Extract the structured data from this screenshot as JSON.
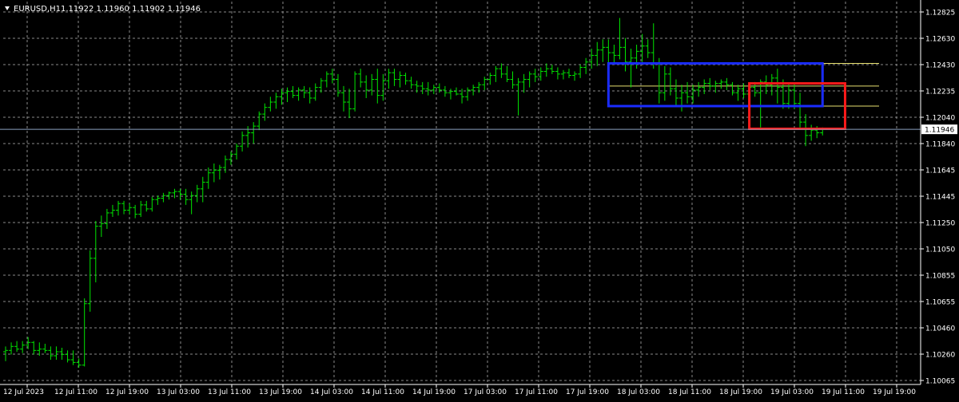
{
  "header": {
    "symbol": "EURUSD,H1",
    "ohlc": "1.11922 1.11960 1.11902 1.11946"
  },
  "chart_data": {
    "type": "ohlc",
    "title": "EURUSD,H1",
    "ylim": [
      1.10065,
      1.12825
    ],
    "y_ticks": [
      "1.12825",
      "1.12630",
      "1.12430",
      "1.12235",
      "1.12040",
      "1.11840",
      "1.11645",
      "1.11445",
      "1.11250",
      "1.11050",
      "1.10855",
      "1.10655",
      "1.10460",
      "1.10260",
      "1.10065"
    ],
    "x_ticks": [
      "12 Jul 2023",
      "12 Jul 11:00",
      "12 Jul 19:00",
      "13 Jul 03:00",
      "13 Jul 11:00",
      "13 Jul 19:00",
      "14 Jul 03:00",
      "14 Jul 11:00",
      "14 Jul 19:00",
      "17 Jul 03:00",
      "17 Jul 11:00",
      "17 Jul 19:00",
      "18 Jul 03:00",
      "18 Jul 11:00",
      "18 Jul 19:00",
      "19 Jul 03:00",
      "19 Jul 11:00",
      "19 Jul 19:00"
    ],
    "current_price": "1.11946",
    "grid": true,
    "colors": {
      "background": "#000000",
      "grid": "#8a8a8a",
      "bars": "#00e600",
      "axis_text": "#ffffff",
      "bid_line": "#8aa0c0",
      "level_line": "#e8e070",
      "box_blue": "#1a2cff",
      "box_red": "#ff1a1a"
    },
    "bars": [
      {
        "o": 1.1028,
        "h": 1.1032,
        "l": 1.1021,
        "c": 1.1029
      },
      {
        "o": 1.1029,
        "h": 1.1035,
        "l": 1.1026,
        "c": 1.1032
      },
      {
        "o": 1.1032,
        "h": 1.1036,
        "l": 1.1028,
        "c": 1.103
      },
      {
        "o": 1.103,
        "h": 1.1036,
        "l": 1.1027,
        "c": 1.1033
      },
      {
        "o": 1.1033,
        "h": 1.1039,
        "l": 1.103,
        "c": 1.1035
      },
      {
        "o": 1.1035,
        "h": 1.1036,
        "l": 1.1026,
        "c": 1.1029
      },
      {
        "o": 1.1029,
        "h": 1.1035,
        "l": 1.1025,
        "c": 1.103
      },
      {
        "o": 1.103,
        "h": 1.1034,
        "l": 1.1027,
        "c": 1.1029
      },
      {
        "o": 1.1029,
        "h": 1.1032,
        "l": 1.1022,
        "c": 1.1025
      },
      {
        "o": 1.1025,
        "h": 1.1032,
        "l": 1.1022,
        "c": 1.1028
      },
      {
        "o": 1.1028,
        "h": 1.1031,
        "l": 1.1022,
        "c": 1.1026
      },
      {
        "o": 1.1026,
        "h": 1.1029,
        "l": 1.102,
        "c": 1.1022
      },
      {
        "o": 1.1022,
        "h": 1.1029,
        "l": 1.1018,
        "c": 1.102
      },
      {
        "o": 1.102,
        "h": 1.1023,
        "l": 1.1016,
        "c": 1.1018
      },
      {
        "o": 1.1018,
        "h": 1.1068,
        "l": 1.1017,
        "c": 1.1064
      },
      {
        "o": 1.1064,
        "h": 1.1104,
        "l": 1.1058,
        "c": 1.1098
      },
      {
        "o": 1.1098,
        "h": 1.1126,
        "l": 1.108,
        "c": 1.1122
      },
      {
        "o": 1.1122,
        "h": 1.113,
        "l": 1.1114,
        "c": 1.1124
      },
      {
        "o": 1.1124,
        "h": 1.1135,
        "l": 1.112,
        "c": 1.1132
      },
      {
        "o": 1.1132,
        "h": 1.1138,
        "l": 1.1129,
        "c": 1.1134
      },
      {
        "o": 1.1134,
        "h": 1.1141,
        "l": 1.113,
        "c": 1.1139
      },
      {
        "o": 1.1139,
        "h": 1.1141,
        "l": 1.1131,
        "c": 1.1134
      },
      {
        "o": 1.1134,
        "h": 1.1139,
        "l": 1.1131,
        "c": 1.1136
      },
      {
        "o": 1.1136,
        "h": 1.1138,
        "l": 1.1128,
        "c": 1.1131
      },
      {
        "o": 1.1131,
        "h": 1.1141,
        "l": 1.1129,
        "c": 1.1138
      },
      {
        "o": 1.1138,
        "h": 1.1141,
        "l": 1.1133,
        "c": 1.1135
      },
      {
        "o": 1.1135,
        "h": 1.1144,
        "l": 1.1133,
        "c": 1.1142
      },
      {
        "o": 1.1142,
        "h": 1.1145,
        "l": 1.1138,
        "c": 1.1143
      },
      {
        "o": 1.1143,
        "h": 1.1147,
        "l": 1.114,
        "c": 1.1145
      },
      {
        "o": 1.1145,
        "h": 1.1148,
        "l": 1.1142,
        "c": 1.1147
      },
      {
        "o": 1.1147,
        "h": 1.115,
        "l": 1.1143,
        "c": 1.1148
      },
      {
        "o": 1.1148,
        "h": 1.115,
        "l": 1.1142,
        "c": 1.1146
      },
      {
        "o": 1.1146,
        "h": 1.115,
        "l": 1.1138,
        "c": 1.1142
      },
      {
        "o": 1.1142,
        "h": 1.1148,
        "l": 1.1131,
        "c": 1.1145
      },
      {
        "o": 1.1145,
        "h": 1.1153,
        "l": 1.114,
        "c": 1.115
      },
      {
        "o": 1.115,
        "h": 1.1159,
        "l": 1.114,
        "c": 1.1155
      },
      {
        "o": 1.1155,
        "h": 1.1166,
        "l": 1.115,
        "c": 1.1162
      },
      {
        "o": 1.1162,
        "h": 1.1169,
        "l": 1.1155,
        "c": 1.1164
      },
      {
        "o": 1.1164,
        "h": 1.1168,
        "l": 1.1157,
        "c": 1.1166
      },
      {
        "o": 1.1166,
        "h": 1.1175,
        "l": 1.1162,
        "c": 1.1172
      },
      {
        "o": 1.1172,
        "h": 1.1178,
        "l": 1.1168,
        "c": 1.1176
      },
      {
        "o": 1.1176,
        "h": 1.1184,
        "l": 1.1172,
        "c": 1.1182
      },
      {
        "o": 1.1182,
        "h": 1.1193,
        "l": 1.1178,
        "c": 1.119
      },
      {
        "o": 1.119,
        "h": 1.1197,
        "l": 1.1181,
        "c": 1.1192
      },
      {
        "o": 1.1192,
        "h": 1.12,
        "l": 1.1184,
        "c": 1.1197
      },
      {
        "o": 1.1197,
        "h": 1.1208,
        "l": 1.1194,
        "c": 1.1206
      },
      {
        "o": 1.1206,
        "h": 1.1214,
        "l": 1.1201,
        "c": 1.1211
      },
      {
        "o": 1.1211,
        "h": 1.1219,
        "l": 1.1208,
        "c": 1.1215
      },
      {
        "o": 1.1215,
        "h": 1.1222,
        "l": 1.121,
        "c": 1.1219
      },
      {
        "o": 1.1219,
        "h": 1.1225,
        "l": 1.1213,
        "c": 1.1222
      },
      {
        "o": 1.1222,
        "h": 1.1226,
        "l": 1.1215,
        "c": 1.1223
      },
      {
        "o": 1.1223,
        "h": 1.1227,
        "l": 1.1218,
        "c": 1.122
      },
      {
        "o": 1.122,
        "h": 1.1226,
        "l": 1.1216,
        "c": 1.1224
      },
      {
        "o": 1.1224,
        "h": 1.1227,
        "l": 1.1218,
        "c": 1.1222
      },
      {
        "o": 1.1222,
        "h": 1.1226,
        "l": 1.1214,
        "c": 1.1218
      },
      {
        "o": 1.1218,
        "h": 1.1229,
        "l": 1.1216,
        "c": 1.1226
      },
      {
        "o": 1.1226,
        "h": 1.1233,
        "l": 1.1222,
        "c": 1.1231
      },
      {
        "o": 1.1231,
        "h": 1.1238,
        "l": 1.1226,
        "c": 1.1236
      },
      {
        "o": 1.1236,
        "h": 1.124,
        "l": 1.1229,
        "c": 1.1232
      },
      {
        "o": 1.1232,
        "h": 1.1236,
        "l": 1.1219,
        "c": 1.1222
      },
      {
        "o": 1.1222,
        "h": 1.1227,
        "l": 1.1208,
        "c": 1.1215
      },
      {
        "o": 1.1215,
        "h": 1.1225,
        "l": 1.1203,
        "c": 1.121
      },
      {
        "o": 1.121,
        "h": 1.1238,
        "l": 1.1208,
        "c": 1.1236
      },
      {
        "o": 1.1236,
        "h": 1.124,
        "l": 1.1226,
        "c": 1.123
      },
      {
        "o": 1.123,
        "h": 1.1235,
        "l": 1.1218,
        "c": 1.1224
      },
      {
        "o": 1.1224,
        "h": 1.1236,
        "l": 1.122,
        "c": 1.1232
      },
      {
        "o": 1.1232,
        "h": 1.124,
        "l": 1.1214,
        "c": 1.122
      },
      {
        "o": 1.122,
        "h": 1.1236,
        "l": 1.1216,
        "c": 1.1231
      },
      {
        "o": 1.1231,
        "h": 1.124,
        "l": 1.1225,
        "c": 1.1237
      },
      {
        "o": 1.1237,
        "h": 1.124,
        "l": 1.1227,
        "c": 1.1232
      },
      {
        "o": 1.1232,
        "h": 1.1238,
        "l": 1.1226,
        "c": 1.1235
      },
      {
        "o": 1.1235,
        "h": 1.1237,
        "l": 1.1228,
        "c": 1.1231
      },
      {
        "o": 1.1231,
        "h": 1.1234,
        "l": 1.1225,
        "c": 1.1228
      },
      {
        "o": 1.1228,
        "h": 1.1231,
        "l": 1.1222,
        "c": 1.1227
      },
      {
        "o": 1.1227,
        "h": 1.123,
        "l": 1.1221,
        "c": 1.1225
      },
      {
        "o": 1.1225,
        "h": 1.123,
        "l": 1.122,
        "c": 1.1224
      },
      {
        "o": 1.1224,
        "h": 1.1228,
        "l": 1.1221,
        "c": 1.1226
      },
      {
        "o": 1.1226,
        "h": 1.1229,
        "l": 1.1222,
        "c": 1.1224
      },
      {
        "o": 1.1224,
        "h": 1.1227,
        "l": 1.1219,
        "c": 1.1222
      },
      {
        "o": 1.1222,
        "h": 1.1225,
        "l": 1.1217,
        "c": 1.1223
      },
      {
        "o": 1.1223,
        "h": 1.1226,
        "l": 1.122,
        "c": 1.1221
      },
      {
        "o": 1.1221,
        "h": 1.1225,
        "l": 1.1214,
        "c": 1.1219
      },
      {
        "o": 1.1219,
        "h": 1.1226,
        "l": 1.1216,
        "c": 1.1224
      },
      {
        "o": 1.1224,
        "h": 1.1228,
        "l": 1.122,
        "c": 1.1226
      },
      {
        "o": 1.1226,
        "h": 1.123,
        "l": 1.1222,
        "c": 1.1228
      },
      {
        "o": 1.1228,
        "h": 1.1234,
        "l": 1.1224,
        "c": 1.1232
      },
      {
        "o": 1.1232,
        "h": 1.1237,
        "l": 1.1228,
        "c": 1.1235
      },
      {
        "o": 1.1235,
        "h": 1.1242,
        "l": 1.123,
        "c": 1.124
      },
      {
        "o": 1.124,
        "h": 1.1244,
        "l": 1.1233,
        "c": 1.1236
      },
      {
        "o": 1.1236,
        "h": 1.1242,
        "l": 1.123,
        "c": 1.1232
      },
      {
        "o": 1.1232,
        "h": 1.1238,
        "l": 1.1225,
        "c": 1.1228
      },
      {
        "o": 1.1228,
        "h": 1.1233,
        "l": 1.1205,
        "c": 1.123
      },
      {
        "o": 1.123,
        "h": 1.1236,
        "l": 1.1222,
        "c": 1.1232
      },
      {
        "o": 1.1232,
        "h": 1.1238,
        "l": 1.1226,
        "c": 1.1236
      },
      {
        "o": 1.1236,
        "h": 1.124,
        "l": 1.123,
        "c": 1.1234
      },
      {
        "o": 1.1234,
        "h": 1.1241,
        "l": 1.1231,
        "c": 1.1238
      },
      {
        "o": 1.1238,
        "h": 1.1244,
        "l": 1.1234,
        "c": 1.124
      },
      {
        "o": 1.124,
        "h": 1.1243,
        "l": 1.1236,
        "c": 1.1238
      },
      {
        "o": 1.1238,
        "h": 1.1241,
        "l": 1.1232,
        "c": 1.1236
      },
      {
        "o": 1.1236,
        "h": 1.1239,
        "l": 1.1232,
        "c": 1.1237
      },
      {
        "o": 1.1237,
        "h": 1.124,
        "l": 1.1233,
        "c": 1.1235
      },
      {
        "o": 1.1235,
        "h": 1.1238,
        "l": 1.1231,
        "c": 1.1236
      },
      {
        "o": 1.1236,
        "h": 1.1243,
        "l": 1.1233,
        "c": 1.1241
      },
      {
        "o": 1.1241,
        "h": 1.1248,
        "l": 1.1236,
        "c": 1.1245
      },
      {
        "o": 1.1245,
        "h": 1.1255,
        "l": 1.124,
        "c": 1.125
      },
      {
        "o": 1.125,
        "h": 1.126,
        "l": 1.1242,
        "c": 1.1254
      },
      {
        "o": 1.1254,
        "h": 1.1262,
        "l": 1.1245,
        "c": 1.1256
      },
      {
        "o": 1.1256,
        "h": 1.1262,
        "l": 1.1244,
        "c": 1.1252
      },
      {
        "o": 1.1252,
        "h": 1.1258,
        "l": 1.1244,
        "c": 1.125
      },
      {
        "o": 1.125,
        "h": 1.1278,
        "l": 1.1247,
        "c": 1.1256
      },
      {
        "o": 1.1256,
        "h": 1.1263,
        "l": 1.1238,
        "c": 1.1245
      },
      {
        "o": 1.1245,
        "h": 1.1255,
        "l": 1.1226,
        "c": 1.1248
      },
      {
        "o": 1.1248,
        "h": 1.1258,
        "l": 1.124,
        "c": 1.1253
      },
      {
        "o": 1.1253,
        "h": 1.1266,
        "l": 1.1245,
        "c": 1.1257
      },
      {
        "o": 1.1257,
        "h": 1.1262,
        "l": 1.1248,
        "c": 1.1252
      },
      {
        "o": 1.1252,
        "h": 1.1274,
        "l": 1.124,
        "c": 1.1244
      },
      {
        "o": 1.1244,
        "h": 1.1248,
        "l": 1.1214,
        "c": 1.1222
      },
      {
        "o": 1.1222,
        "h": 1.1242,
        "l": 1.1216,
        "c": 1.1236
      },
      {
        "o": 1.1236,
        "h": 1.1241,
        "l": 1.122,
        "c": 1.1225
      },
      {
        "o": 1.1225,
        "h": 1.1232,
        "l": 1.1212,
        "c": 1.1218
      },
      {
        "o": 1.1218,
        "h": 1.1228,
        "l": 1.1208,
        "c": 1.1222
      },
      {
        "o": 1.1222,
        "h": 1.123,
        "l": 1.1214,
        "c": 1.1219
      },
      {
        "o": 1.1219,
        "h": 1.1228,
        "l": 1.1214,
        "c": 1.1224
      },
      {
        "o": 1.1224,
        "h": 1.123,
        "l": 1.1219,
        "c": 1.1226
      },
      {
        "o": 1.1226,
        "h": 1.1232,
        "l": 1.1221,
        "c": 1.1229
      },
      {
        "o": 1.1229,
        "h": 1.1233,
        "l": 1.1224,
        "c": 1.1227
      },
      {
        "o": 1.1227,
        "h": 1.1231,
        "l": 1.1222,
        "c": 1.1229
      },
      {
        "o": 1.1229,
        "h": 1.1232,
        "l": 1.1225,
        "c": 1.123
      },
      {
        "o": 1.123,
        "h": 1.1233,
        "l": 1.1224,
        "c": 1.1228
      },
      {
        "o": 1.1228,
        "h": 1.123,
        "l": 1.122,
        "c": 1.1222
      },
      {
        "o": 1.1222,
        "h": 1.1228,
        "l": 1.1216,
        "c": 1.1225
      },
      {
        "o": 1.1225,
        "h": 1.1229,
        "l": 1.1218,
        "c": 1.1221
      },
      {
        "o": 1.1221,
        "h": 1.1228,
        "l": 1.1217,
        "c": 1.1226
      },
      {
        "o": 1.1226,
        "h": 1.123,
        "l": 1.1219,
        "c": 1.1222
      },
      {
        "o": 1.1222,
        "h": 1.1232,
        "l": 1.1196,
        "c": 1.123
      },
      {
        "o": 1.123,
        "h": 1.1235,
        "l": 1.1221,
        "c": 1.1228
      },
      {
        "o": 1.1228,
        "h": 1.1236,
        "l": 1.122,
        "c": 1.1233
      },
      {
        "o": 1.1233,
        "h": 1.124,
        "l": 1.1214,
        "c": 1.1226
      },
      {
        "o": 1.1226,
        "h": 1.1232,
        "l": 1.121,
        "c": 1.1214
      },
      {
        "o": 1.1214,
        "h": 1.1228,
        "l": 1.121,
        "c": 1.1224
      },
      {
        "o": 1.1224,
        "h": 1.1229,
        "l": 1.121,
        "c": 1.1214
      },
      {
        "o": 1.1214,
        "h": 1.1222,
        "l": 1.1196,
        "c": 1.12
      },
      {
        "o": 1.12,
        "h": 1.1206,
        "l": 1.1182,
        "c": 1.119
      },
      {
        "o": 1.119,
        "h": 1.1198,
        "l": 1.1186,
        "c": 1.1194
      },
      {
        "o": 1.1194,
        "h": 1.1197,
        "l": 1.1188,
        "c": 1.1192
      },
      {
        "o": 1.1192,
        "h": 1.1196,
        "l": 1.119,
        "c": 1.11946
      }
    ],
    "levels": [
      {
        "value": 1.1244
      },
      {
        "value": 1.1227
      },
      {
        "value": 1.1212
      }
    ],
    "boxes": [
      {
        "name": "blue",
        "x_start": 107,
        "x_end": 145,
        "top": 1.1244,
        "bottom": 1.1212
      },
      {
        "name": "red",
        "x_start": 132,
        "x_end": 149,
        "top": 1.1229,
        "bottom": 1.1195
      }
    ]
  }
}
